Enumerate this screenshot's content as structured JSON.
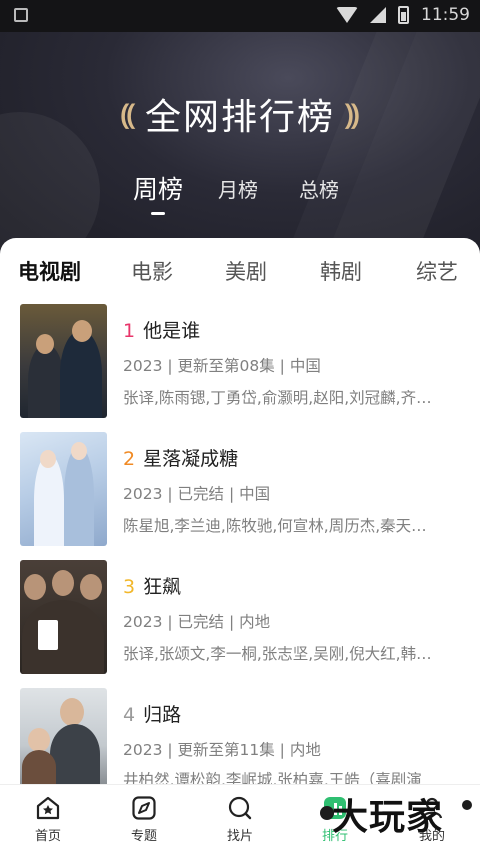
{
  "status_bar": {
    "time": "11:59"
  },
  "header": {
    "title": "全网排行榜",
    "period_tabs": [
      {
        "label": "周榜",
        "active": true
      },
      {
        "label": "月榜",
        "active": false
      },
      {
        "label": "总榜",
        "active": false
      }
    ]
  },
  "category_tabs": [
    {
      "label": "电视剧",
      "active": true
    },
    {
      "label": "电影",
      "active": false
    },
    {
      "label": "美剧",
      "active": false
    },
    {
      "label": "韩剧",
      "active": false
    },
    {
      "label": "综艺",
      "active": false
    }
  ],
  "rank_colors": [
    "#e8356a",
    "#f08a24",
    "#f2b72a",
    "#9a9a9a"
  ],
  "items": [
    {
      "rank": "1",
      "title": "他是谁",
      "meta": "2023 | 更新至第08集 | 中国",
      "cast": "张译,陈雨锶,丁勇岱,俞灏明,赵阳,刘冠麟,齐…"
    },
    {
      "rank": "2",
      "title": "星落凝成糖",
      "meta": "2023 | 已完结 | 中国",
      "cast": "陈星旭,李兰迪,陈牧驰,何宣林,周历杰,秦天…"
    },
    {
      "rank": "3",
      "title": "狂飙",
      "meta": "2023 | 已完结 | 内地",
      "cast": "张译,张颂文,李一桐,张志坚,吴刚,倪大红,韩…"
    },
    {
      "rank": "4",
      "title": "归路",
      "meta": "2023 | 更新至第11集 | 内地",
      "cast": "井柏然,谭松韵,李岷城,张柏嘉,王皓（喜剧演"
    }
  ],
  "bottom_nav": [
    {
      "label": "首页",
      "icon": "home-icon",
      "active": false
    },
    {
      "label": "专题",
      "icon": "compass-icon",
      "active": false
    },
    {
      "label": "找片",
      "icon": "search-icon",
      "active": false
    },
    {
      "label": "排行",
      "icon": "chart-icon",
      "active": true
    },
    {
      "label": "我的",
      "icon": "user-icon",
      "active": false
    }
  ],
  "watermark": "大玩家"
}
